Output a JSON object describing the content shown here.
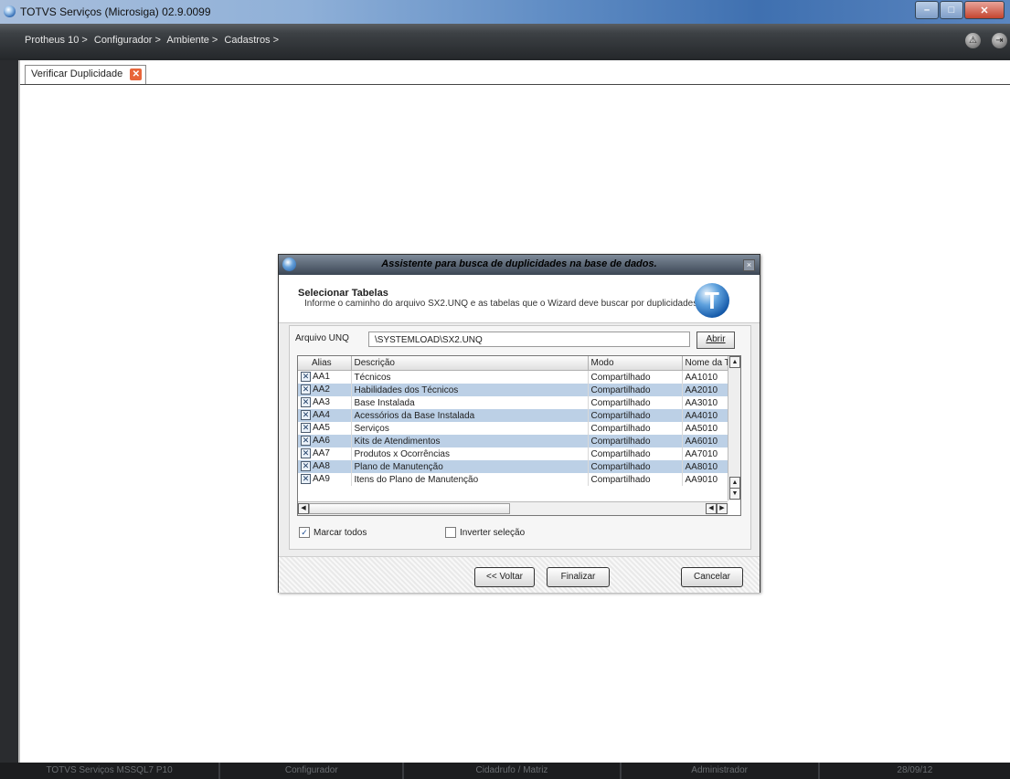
{
  "window": {
    "title": "TOTVS Serviços (Microsiga) 02.9.0099"
  },
  "menubar": {
    "breadcrumb": [
      "Protheus 10 >",
      "Configurador >",
      "Ambiente >",
      "Cadastros >"
    ]
  },
  "tab": {
    "label": "Verificar Duplicidade"
  },
  "dialog": {
    "title": "Assistente para busca de duplicidades na base de dados.",
    "header_title": "Selecionar Tabelas",
    "header_desc": "Informe o caminho do arquivo SX2.UNQ e as tabelas que o Wizard deve buscar por duplicidades.",
    "arquivo_label": "Arquivo UNQ",
    "arquivo_value": "\\SYSTEMLOAD\\SX2.UNQ",
    "abrir_label": "Abrir",
    "columns": [
      "Alias",
      "Descrição",
      "Modo",
      "Nome da T"
    ],
    "rows": [
      {
        "alias": "AA1",
        "desc": "Técnicos",
        "modo": "Compartilhado",
        "nome": "AA1010"
      },
      {
        "alias": "AA2",
        "desc": "Habilidades dos Técnicos",
        "modo": "Compartilhado",
        "nome": "AA2010"
      },
      {
        "alias": "AA3",
        "desc": "Base Instalada",
        "modo": "Compartilhado",
        "nome": "AA3010"
      },
      {
        "alias": "AA4",
        "desc": "Acessórios da Base Instalada",
        "modo": "Compartilhado",
        "nome": "AA4010"
      },
      {
        "alias": "AA5",
        "desc": "Serviços",
        "modo": "Compartilhado",
        "nome": "AA5010"
      },
      {
        "alias": "AA6",
        "desc": "Kits de Atendimentos",
        "modo": "Compartilhado",
        "nome": "AA6010"
      },
      {
        "alias": "AA7",
        "desc": "Produtos x Ocorrências",
        "modo": "Compartilhado",
        "nome": "AA7010"
      },
      {
        "alias": "AA8",
        "desc": "Plano de Manutenção",
        "modo": "Compartilhado",
        "nome": "AA8010"
      },
      {
        "alias": "AA9",
        "desc": "Itens do Plano de Manutenção",
        "modo": "Compartilhado",
        "nome": "AA9010"
      }
    ],
    "marcar_todos": "Marcar todos",
    "inverter": "Inverter seleção",
    "voltar": "<< Voltar",
    "finalizar": "Finalizar",
    "cancelar": "Cancelar"
  },
  "statusbar": [
    "TOTVS Serviços MSSQL7 P10",
    "Configurador",
    "Cidadrufo / Matriz",
    "Administrador",
    "28/09/12"
  ]
}
